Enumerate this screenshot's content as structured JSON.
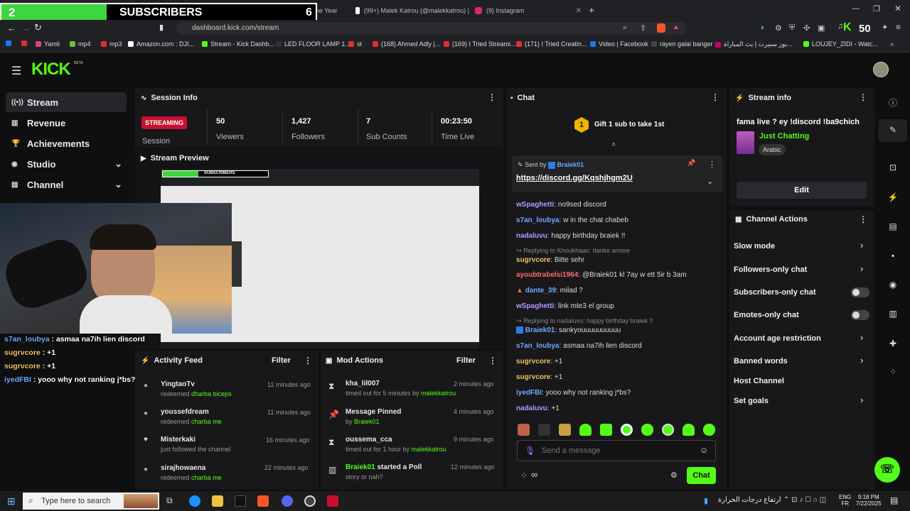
{
  "overlay": {
    "count": "2",
    "label": "SUBSCRIBERS",
    "goal": "6"
  },
  "browser": {
    "tabs": [
      {
        "label": "(65) Khantrast - M... The Year",
        "color": "#e03030"
      },
      {
        "label": "(99+) Malek Katrou (@malekkatrou) |",
        "color": "#ffffff"
      },
      {
        "label": "(9) Instagram",
        "color": "#d62976"
      }
    ],
    "new_tab": "+",
    "url": "dashboard.kick.com/stream",
    "ext_badge": "50",
    "bookmarks": [
      "Yamli",
      "mp4",
      "mp3",
      "Amazon.com : DJI...",
      "Stream - Kick Dashb...",
      "LED FLOOR LAMP 1...",
      "st",
      "(168) Ahmed Adly |...",
      "(169) I Tried Streami...",
      "(171) I Tried Creatin...",
      "Video | Facebook",
      "rayen galai banger",
      "بوز سبيرت | بث المباراة...",
      "LOUJEY_ZIDI - Watc..."
    ]
  },
  "kick": {
    "logo": "KICK",
    "logo_sup": "BETA",
    "nav": [
      "Stream",
      "Revenue",
      "Achievements",
      "Studio",
      "Channel"
    ],
    "session": {
      "title": "Session Info",
      "status": "STREAMING",
      "status_label": "Session",
      "stats": [
        {
          "value": "50",
          "label": "Viewers"
        },
        {
          "value": "1,427",
          "label": "Followers"
        },
        {
          "value": "7",
          "label": "Sub Counts"
        },
        {
          "value": "00:23:50",
          "label": "Time Live"
        }
      ]
    },
    "preview": {
      "title": "Stream Preview",
      "mini_label": "SUBSCRIBERS"
    },
    "activity": {
      "title": "Activity Feed",
      "filter": "Filter",
      "items": [
        {
          "name": "YingtaoTv",
          "action": "redeemed",
          "reward": "dharba biceps",
          "time": "11 minutes ago"
        },
        {
          "name": "youssefdream",
          "action": "redeemed",
          "reward": "charba me",
          "time": "11 minutes ago"
        },
        {
          "name": "Misterkaki",
          "action": "just followed the channel",
          "reward": "",
          "time": "16 minutes ago"
        },
        {
          "name": "sirajhowaena",
          "action": "redeemed",
          "reward": "charba me",
          "time": "22 minutes ago"
        }
      ]
    },
    "mod": {
      "title": "Mod Actions",
      "filter": "Filter",
      "items": [
        {
          "name": "kha_lil007",
          "detail": "timed out for 5 minutes by",
          "by": "malekkatrou",
          "time": "2 minutes ago"
        },
        {
          "name": "Message Pinned",
          "detail": "by",
          "by": "Braiek01",
          "time": "4 minutes ago"
        },
        {
          "name": "oussema_cca",
          "detail": "timed out for 1 hour by",
          "by": "malekkatrou",
          "time": "9 minutes ago"
        },
        {
          "name": "Braiek01",
          "detail": "story or nah?",
          "by": "",
          "time": "12 minutes ago",
          "suffix": "started a Poll"
        }
      ]
    },
    "chat": {
      "title": "Chat",
      "gift_num": "1",
      "gift_text": "Gift 1 sub to take 1st",
      "pinned_sent_by": "Sent by",
      "pinned_user": "Braiek01",
      "pinned_link": "https://discord.gg/Kqshjhgm2U",
      "messages": [
        {
          "user": "wSpaghetti",
          "color": "#b896ff",
          "text": ": no9sed discord"
        },
        {
          "user": "s7an_loubya",
          "color": "#6fa8ff",
          "text": ": w in the chat chabeb"
        },
        {
          "user": "nadaluvu",
          "color": "#b896ff",
          "text": ": happy birthday braiek !!"
        },
        {
          "reply": "Replying to Khoukhaax: danke amore",
          "user": "sugrvcore",
          "color": "#f0c060",
          "text": ": Bitte sehr"
        },
        {
          "user": "ayoubtrabelsi1964",
          "color": "#ff6b6b",
          "text": ": @Braiek01 kl 7ay w ett 5ir b 3am"
        },
        {
          "user": "dante_39",
          "color": "#6fa8ff",
          "text": ": milad ?"
        },
        {
          "user": "wSpaghetti",
          "color": "#b896ff",
          "text": ": link mte3 el group"
        },
        {
          "reply": "Replying to nadaluvu: happy birthday braiek !!",
          "user": "Braiek01",
          "color": "#6fa8ff",
          "text": ": sankyouuuuuuuuuu"
        },
        {
          "user": "s7an_loubya",
          "color": "#6fa8ff",
          "text": ": asmaa na7ih lien discord"
        },
        {
          "user": "sugrvcore",
          "color": "#f0c060",
          "text": ": +1"
        },
        {
          "user": "sugrvcore",
          "color": "#f0c060",
          "text": ": +1"
        },
        {
          "user": "iyedFBI",
          "color": "#6fa8ff",
          "text": ": yooo why not ranking j*bs?"
        },
        {
          "user": "nadaluvu",
          "color": "#b896ff",
          "text": ": +1"
        }
      ],
      "placeholder": "Send a message",
      "send": "Chat"
    },
    "stream_info": {
      "title": "Stream info",
      "stream_title": "fama live ? ey !discord !ba9chich",
      "category": "Just Chatting",
      "tag": "Arabic",
      "edit": "Edit"
    },
    "channel_actions": {
      "title": "Channel Actions",
      "items": [
        {
          "label": "Slow mode",
          "kind": "chevron"
        },
        {
          "label": "Followers-only chat",
          "kind": "chevron"
        },
        {
          "label": "Subscribers-only chat",
          "kind": "toggle"
        },
        {
          "label": "Emotes-only chat",
          "kind": "toggle"
        },
        {
          "label": "Account age restriction",
          "kind": "chevron"
        },
        {
          "label": "Banned words",
          "kind": "chevron"
        },
        {
          "label": "Host Channel",
          "kind": "none"
        },
        {
          "label": "Set goals",
          "kind": "chevron"
        }
      ]
    }
  },
  "cam_overlay_chat": [
    {
      "user": "s7an_loubya",
      "color": "#6fa8ff",
      "text": " : asmaa na7ih lien discord"
    },
    {
      "user": "sugrvcore",
      "color": "#f0c060",
      "text": " : +1"
    },
    {
      "user": "sugrvcore",
      "color": "#f0c060",
      "text": " : +1"
    },
    {
      "user": "iyedFBI",
      "color": "#6fa8ff",
      "text": " : yooo why not ranking j*bs?"
    }
  ],
  "taskbar": {
    "search": "Type here to search",
    "weather": "ارتفاع درجات الحرارة",
    "lang": "ENG",
    "lang2": "FR",
    "time": "9:18 PM",
    "date": "7/22/2025"
  }
}
